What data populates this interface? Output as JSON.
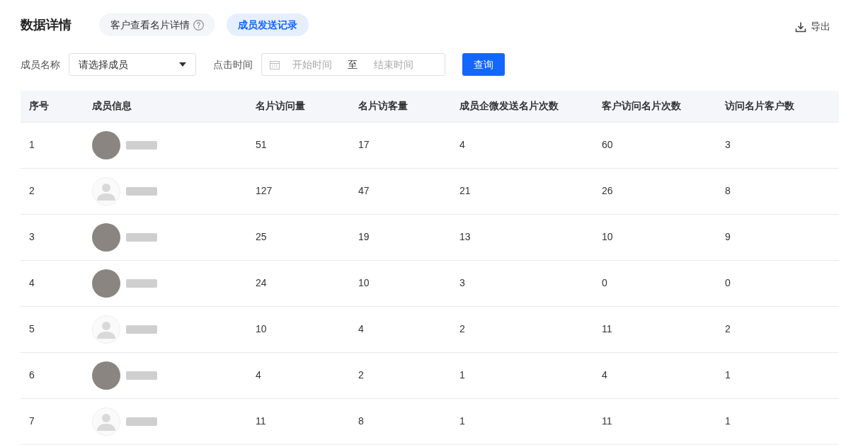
{
  "header": {
    "title": "数据详情",
    "tabs": [
      {
        "label": "客户查看名片详情",
        "help": true,
        "selected": false
      },
      {
        "label": "成员发送记录",
        "help": false,
        "selected": true
      }
    ],
    "export": "导出"
  },
  "filters": {
    "member": {
      "label": "成员名称",
      "placeholder": "请选择成员"
    },
    "time": {
      "label": "点击时间",
      "start_placeholder": "开始时间",
      "separator": "至",
      "end_placeholder": "结束时间"
    },
    "query_button": "查询"
  },
  "table": {
    "columns": [
      "序号",
      "成员信息",
      "名片访问量",
      "名片访客量",
      "成员企微发送名片次数",
      "客户访问名片次数",
      "访问名片客户数"
    ],
    "rows": [
      {
        "cells": [
          "1",
          {
            "kind": "photo"
          },
          "51",
          "17",
          "4",
          "60",
          "3"
        ]
      },
      {
        "cells": [
          "2",
          {
            "kind": "default"
          },
          "127",
          "47",
          "21",
          "26",
          "8"
        ]
      },
      {
        "cells": [
          "3",
          {
            "kind": "photo"
          },
          "25",
          "19",
          "13",
          "10",
          "9"
        ]
      },
      {
        "cells": [
          "4",
          {
            "kind": "photo"
          },
          "24",
          "10",
          "3",
          "0",
          "0"
        ]
      },
      {
        "cells": [
          "5",
          {
            "kind": "default"
          },
          "10",
          "4",
          "2",
          "11",
          "2"
        ]
      },
      {
        "cells": [
          "6",
          {
            "kind": "photo"
          },
          "4",
          "2",
          "1",
          "4",
          "1"
        ]
      },
      {
        "cells": [
          "7",
          {
            "kind": "default"
          },
          "11",
          "8",
          "1",
          "11",
          "1"
        ]
      }
    ]
  }
}
